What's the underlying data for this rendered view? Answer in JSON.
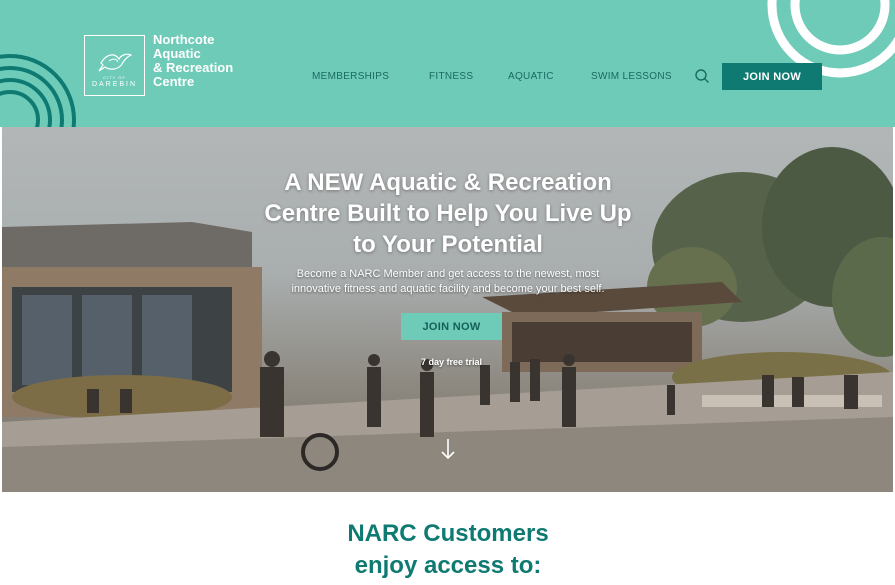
{
  "header": {
    "logo": {
      "small_text": "CITY OF",
      "city": "DAREBIN"
    },
    "brand": {
      "line1": "Northcote",
      "line2": "Aquatic",
      "line3": "& Recreation",
      "line4": "Centre"
    },
    "nav": [
      {
        "label": "MEMBERSHIPS"
      },
      {
        "label": "FITNESS"
      },
      {
        "label": "AQUATIC"
      },
      {
        "label": "SWIM LESSONS"
      }
    ],
    "search_icon": "search-icon",
    "join_label": "JOIN NOW"
  },
  "hero": {
    "title_line1": "A NEW Aquatic & Recreation",
    "title_line2": "Centre Built to Help You Live Up",
    "title_line3": "to Your Potential",
    "subtitle_line1": "Become a NARC Member and get access to the newest, most",
    "subtitle_line2": "innovative fitness and aquatic facility and become your best self.",
    "join_label": "JOIN NOW",
    "trial_text": "7 day free trial",
    "scroll_icon": "arrow-down-icon"
  },
  "section": {
    "title_line1": "NARC Customers",
    "title_line2": "enjoy access to:"
  },
  "colors": {
    "header_bg": "#6ecbb7",
    "primary_dark": "#0f7a72",
    "nav_text": "#1a6a63",
    "white": "#ffffff"
  }
}
